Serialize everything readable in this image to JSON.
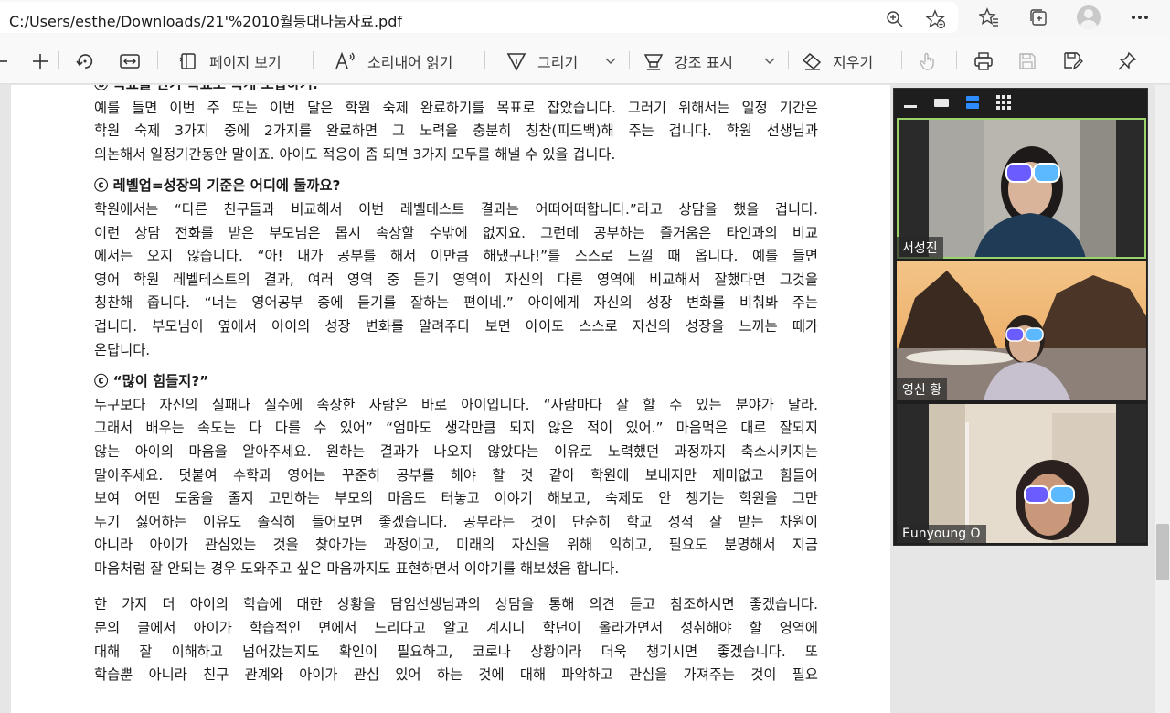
{
  "address_bar": {
    "url": "C:/Users/esthe/Downloads/21'%2010월등대나눔자료.pdf",
    "icons": [
      "zoom-icon",
      "add-favorite-icon",
      "favorites-icon",
      "collections-icon",
      "profile-avatar",
      "more-icon"
    ]
  },
  "toolbar": {
    "page_view_label": "페이지 보기",
    "read_aloud_label": "소리내어 읽기",
    "draw_label": "그리기",
    "highlight_label": "강조 표시",
    "erase_label": "지우기"
  },
  "document": {
    "paragraphs": [
      {
        "lines": [
          "예를 들면 이번 주 또는 이번 달은 학원 숙제 완료하기를 목표로 잡았습니다. 그러기 위해서는 일정 기간은",
          "학원 숙제 3가지 중에 2가지를 완료하면 그 노력을 충분히 칭찬(피드백)해 주는 겁니다. 학원 선생님과",
          "의논해서 일정기간동안 말이죠. 아이도 적응이 좀 되면 3가지 모두를 해낼 수 있을 겁니다."
        ]
      },
      {
        "heading": "ⓒ 레벨업=성장의 기준은 어디에 둘까요?",
        "lines": [
          "학원에서는 “다른 친구들과 비교해서 이번 레벨테스트 결과는 어떠어떠합니다.”라고 상담을 했을 겁니다.",
          "이런 상담 전화를 받은 부모님은 몹시 속상할 수밖에 없지요. 그런데 공부하는 즐거움은 타인과의 비교",
          "에서는 오지 않습니다. “아! 내가 공부를 해서 이만큼 해냈구나!”를 스스로 느낄 때 옵니다. 예를 들면",
          "영어 학원 레벨테스트의 결과, 여러 영역 중 듣기 영역이 자신의 다른 영역에 비교해서 잘했다면 그것을",
          "칭찬해 줍니다. “너는 영어공부 중에 듣기를 잘하는 편이네.” 아이에게 자신의 성장 변화를 비춰봐 주는",
          "겁니다. 부모님이 옆에서 아이의 성장 변화를 알려주다 보면 아이도 스스로 자신의 성장을 느끼는 때가",
          "온답니다."
        ]
      },
      {
        "heading": "ⓒ “많이 힘들지?”",
        "lines": [
          "누구보다 자신의 실패나 실수에 속상한 사람은 바로 아이입니다. “사람마다 잘 할 수 있는 분야가 달라.",
          "그래서 배우는 속도는 다 다를 수 있어” “엄마도 생각만큼 되지 않은 적이 있어.” 마음먹은 대로 잘되지",
          "않는 아이의 마음을 알아주세요. 원하는 결과가 나오지 않았다는 이유로 노력했던 과정까지 축소시키지는",
          "말아주세요. 덧붙여 수학과 영어는 꾸준히 공부를 해야 할 것 같아 학원에 보내지만 재미없고 힘들어",
          "보여 어떤 도움을 줄지 고민하는 부모의 마음도 터놓고 이야기 해보고, 숙제도 안 챙기는 학원을 그만",
          "두기 싫어하는 이유도 솔직히 들어보면 좋겠습니다. 공부라는 것이 단순히 학교 성적 잘 받는 차원이",
          "아니라 아이가 관심있는 것을 찾아가는 과정이고, 미래의 자신을 위해 익히고, 필요도 분명해서 지금",
          "마음처럼 잘 안되는 경우 도와주고 싶은 마음까지도 표현하면서 이야기를 해보셨음 합니다."
        ]
      },
      {
        "lines": [
          "한 가지 더  아이의 학습에 대한 상황을 담임선생님과의 상담을 통해 의견 듣고 참조하시면 좋겠습니다.",
          "문의 글에서 아이가 학습적인 면에서 느리다고 알고 계시니 학년이 올라가면서 성취해야 할 영역에",
          "대해 잘 이해하고 넘어갔는지도 확인이 필요하고, 코로나 상황이라 더욱 챙기시면 좋겠습니다. 또",
          "학습뿐 아니라 친구 관계와 아이가 관심 있어 하는 것에 대해 파악하고 관심을 가져주는 것이 필요"
        ]
      }
    ]
  },
  "video_call": {
    "participants": [
      {
        "name": "서성진",
        "active": true
      },
      {
        "name": "영신 황",
        "active": false
      },
      {
        "name": "Eunyoung O",
        "active": false
      }
    ]
  },
  "colors": {
    "active_speaker_border": "#9bd36b",
    "view_selected": "#2d8cff",
    "sunglasses": "#6a5cff"
  }
}
